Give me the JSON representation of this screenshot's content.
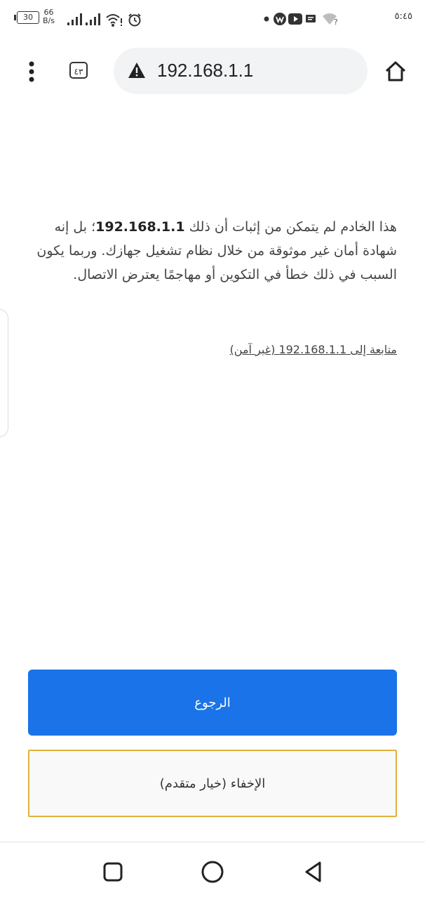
{
  "status_bar": {
    "battery_level": "30",
    "net_speed_value": "66",
    "net_speed_unit": "B/s",
    "time": "٥:٤٥",
    "icons": [
      "signal-icon",
      "wifi-icon",
      "alarm-icon",
      "notification-dot-icon",
      "app-icon",
      "youtube-icon",
      "message-icon",
      "wifi-no-internet-icon"
    ]
  },
  "toolbar": {
    "tab_count": "٤٣",
    "url": "192.168.1.1",
    "icons": [
      "menu-icon",
      "warning-icon",
      "home-icon"
    ]
  },
  "content": {
    "message_part1": "هذا الخادم لم يتمكن من إثبات أن ذلك ",
    "message_host": "192.168.1.1",
    "message_part2": "؛ بل إنه شهادة أمان غير موثوقة من خلال نظام تشغيل جهازك. وربما يكون السبب في ذلك خطأ في التكوين أو مهاجمًا يعترض الاتصال.",
    "proceed_link": "متابعة إلى 192.168.1.1 (غير آمن)"
  },
  "buttons": {
    "back": "الرجوع",
    "advanced": "الإخفاء (خيار متقدم)"
  },
  "colors": {
    "primary_button": "#1a73e8",
    "advanced_border": "#e0b13c",
    "url_bar_bg": "#f1f3f4"
  },
  "nav_bar": {
    "icons": [
      "recent-apps-icon",
      "home-circle-icon",
      "back-triangle-icon"
    ]
  }
}
